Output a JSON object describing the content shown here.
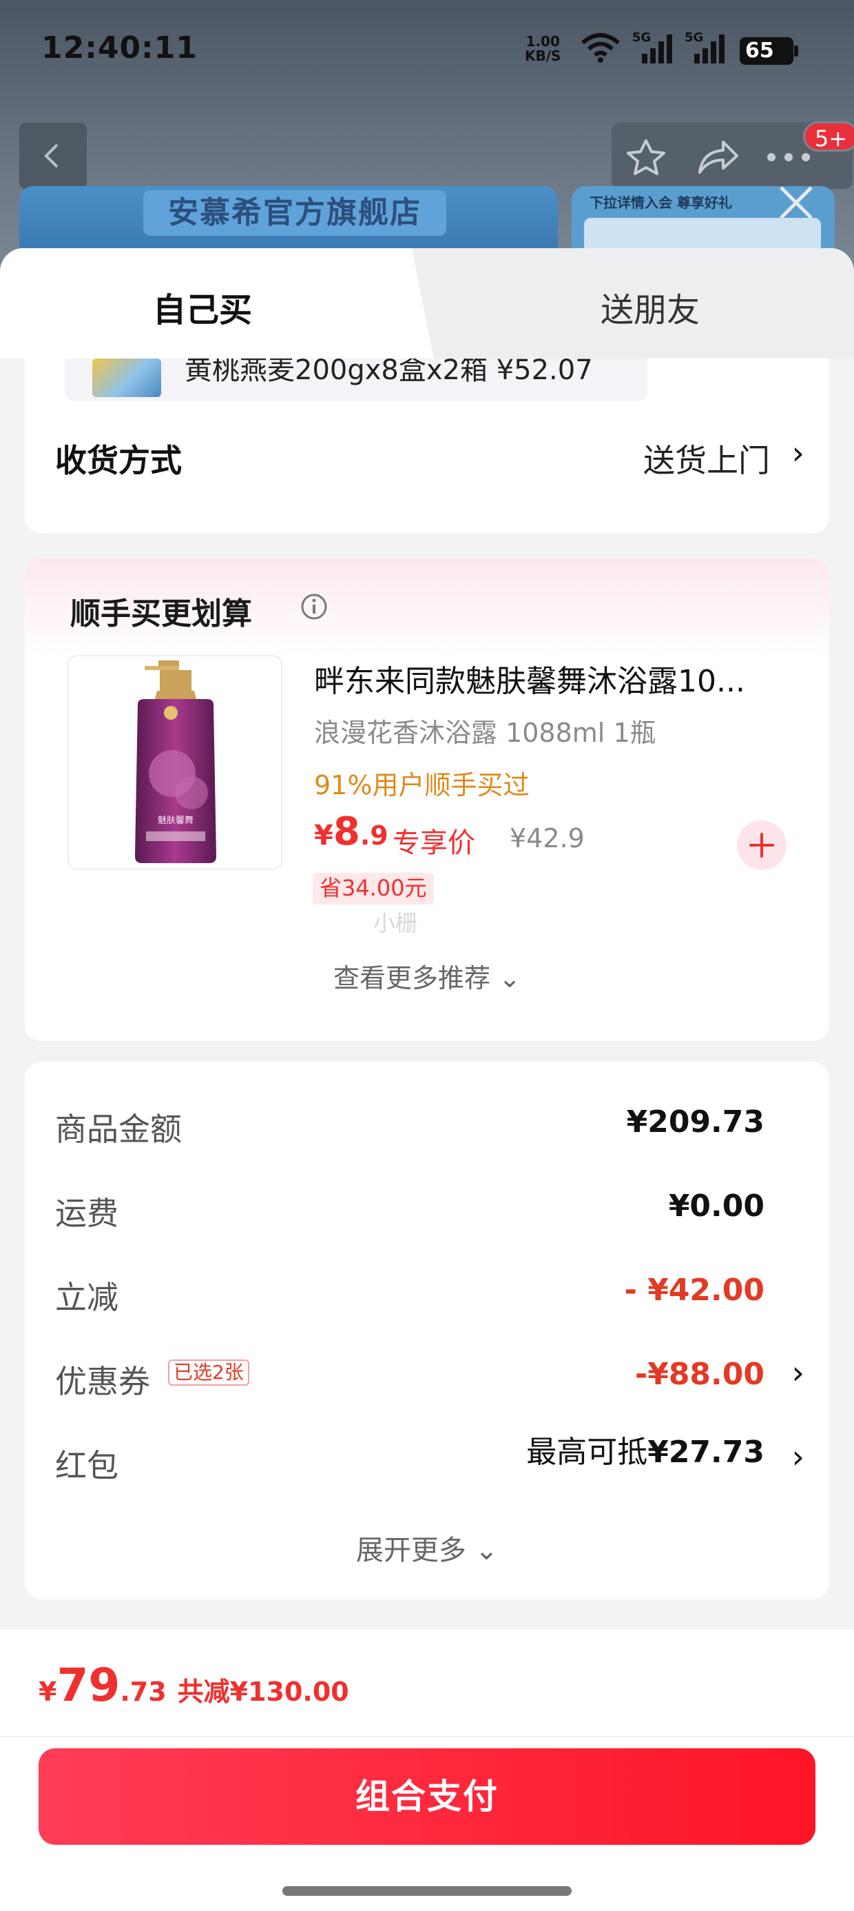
{
  "status_bar": {
    "time": "12:40:11",
    "net_speed_value": "1.00",
    "net_speed_unit": "KB/S",
    "signal_1": "5G",
    "signal_2": "5G",
    "battery": "65"
  },
  "nav": {
    "badge": "5+",
    "icons": [
      "back-icon",
      "star-icon",
      "share-icon",
      "more-icon"
    ]
  },
  "background": {
    "store_banner_title": "安慕希官方旗舰店",
    "side_banner_text": "下拉详情入会 尊享好礼"
  },
  "tabs": [
    {
      "label": "自己买",
      "active": true
    },
    {
      "label": "送朋友",
      "active": false
    }
  ],
  "gift_item": {
    "text": "黄桃燕麦200gx8盒x2箱 ¥52.07"
  },
  "delivery": {
    "label": "收货方式",
    "value": "送货上门"
  },
  "addon": {
    "title": "顺手买更划算",
    "product": {
      "title": "畔东来同款魅肤馨舞沐浴露10...",
      "subtitle": "浪漫花香沐浴露 1088ml 1瓶",
      "buyers_text": "91%用户顺手买过",
      "price_currency": "¥",
      "price_int": "8",
      "price_dec": ".9",
      "exclusive_label": "专享价",
      "original_price": "¥42.9",
      "save_tag": "省34.00元",
      "image_brand": "魅肤馨舞"
    },
    "watermark": "小栅",
    "more_label": "查看更多推荐"
  },
  "summary": {
    "rows": [
      {
        "label": "商品金额",
        "value": "¥209.73"
      },
      {
        "label": "运费",
        "value": "¥0.00"
      },
      {
        "label": "立减",
        "value": "- ¥42.00"
      },
      {
        "label": "优惠券",
        "tag": "已选2张",
        "value": "-¥88.00"
      },
      {
        "label": "红包",
        "value_prefix": "最高可抵",
        "value": "¥27.73"
      }
    ],
    "expand_label": "展开更多"
  },
  "footer": {
    "total_currency": "¥",
    "total_int": "79",
    "total_dec": ".73",
    "total_off": "共减¥130.00",
    "pay_button": "组合支付"
  },
  "colors": {
    "accent_red": "#f0302e",
    "button_gradient_start": "#ff3d56",
    "button_gradient_end": "#fe1526",
    "buyers_orange": "#e0891b"
  }
}
